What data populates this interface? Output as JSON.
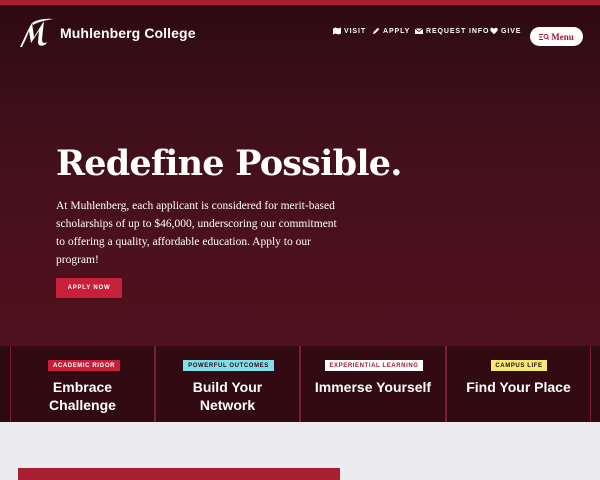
{
  "header": {
    "brand": "Muhlenberg College",
    "nav": [
      {
        "label": "VISIT",
        "icon": "map-icon"
      },
      {
        "label": "APPLY",
        "icon": "pencil-icon"
      },
      {
        "label": "REQUEST INFO",
        "icon": "envelope-icon"
      },
      {
        "label": "GIVE",
        "icon": "heart-icon"
      }
    ],
    "menu_label": "Menu"
  },
  "hero": {
    "title": "Redefine Possible.",
    "body": "At Muhlenberg, each applicant is considered for merit-based scholarships of up to $46,000, underscoring our commitment to offering a quality, affordable education. Apply to our program!",
    "cta": "APPLY NOW"
  },
  "pillars": [
    {
      "tag": "ACADEMIC RIGOR",
      "title_line1": "Embrace",
      "title_line2": "Challenge",
      "tag_bg": "#c8203a",
      "tag_color": "#ffffff"
    },
    {
      "tag": "POWERFUL OUTCOMES",
      "title_line1": "Build Your",
      "title_line2": "Network",
      "tag_bg": "#7fe0ea",
      "tag_color": "#2d0910"
    },
    {
      "tag": "EXPERIENTIAL LEARNING",
      "title_line1": "Immerse Yourself",
      "title_line2": "",
      "tag_bg": "#ffffff",
      "tag_color": "#a3172d"
    },
    {
      "tag": "CAMPUS LIFE",
      "title_line1": "Find Your Place",
      "title_line2": "",
      "tag_bg": "#f3ea78",
      "tag_color": "#2d0910"
    }
  ],
  "colors": {
    "brand_red": "#a91f32",
    "hero_bg": "#4b111c",
    "cta": "#c8203a",
    "page_bg": "#ececef"
  }
}
